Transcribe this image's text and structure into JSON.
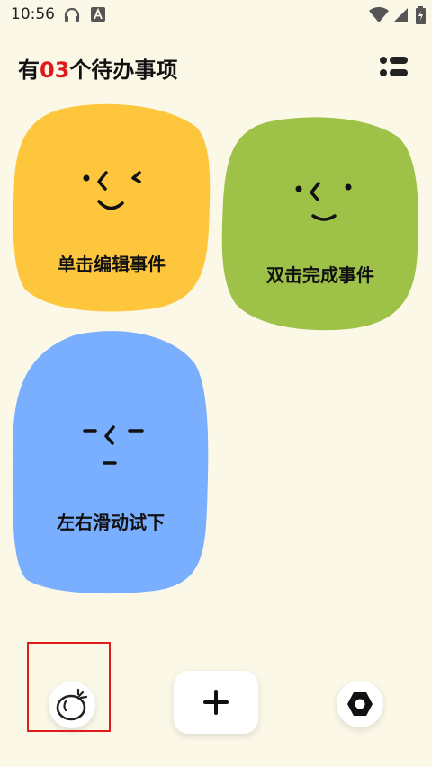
{
  "status_bar": {
    "time": "10:56",
    "icons": [
      "headset-icon",
      "a-badge-icon",
      "wifi-icon",
      "signal-icon",
      "battery-icon"
    ]
  },
  "header": {
    "title_prefix": "有",
    "title_count": "03",
    "title_suffix": "个待办事项",
    "count_color": "#e0191b",
    "menu_icon": "list-menu-icon"
  },
  "cards": [
    {
      "label": "单击编辑事件",
      "color": "#fdc63c"
    },
    {
      "label": "双击完成事件",
      "color": "#9ec148"
    },
    {
      "label": "左右滑动试下",
      "color": "#7aaeff"
    }
  ],
  "bottom_bar": {
    "left_icon": "tomato-icon",
    "center_icon": "plus-icon",
    "right_icon": "hexagon-settings-icon",
    "highlight_color": "#e01d1d"
  }
}
